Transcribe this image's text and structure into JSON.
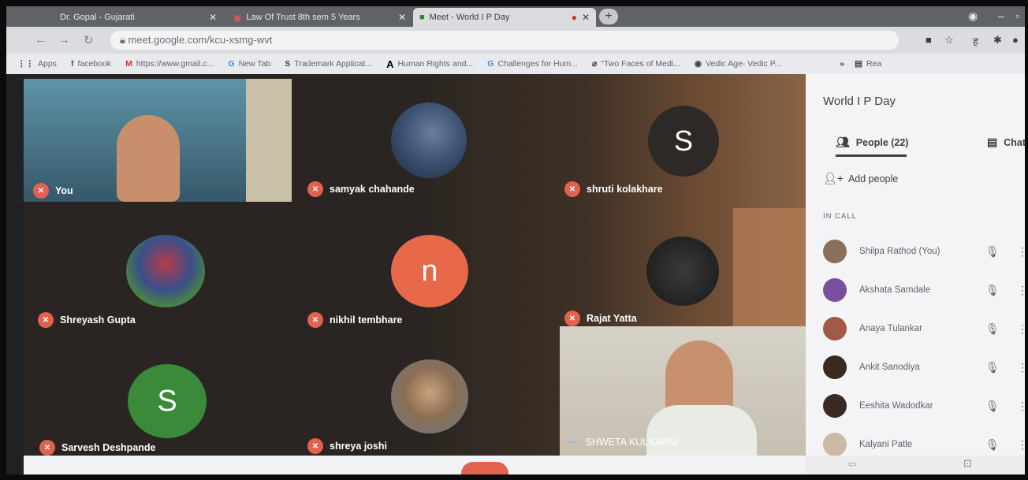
{
  "browser": {
    "tabs": [
      {
        "label": "Dr. Gopal - Gujarati"
      },
      {
        "label": "Law Of Trust 8th sem 5 Years"
      },
      {
        "label": "Meet - World I P Day"
      }
    ],
    "url": "meet.google.com/kcu-xsmg-wvt",
    "bookmarks": [
      {
        "icon": "⋮⋮",
        "label": "Apps"
      },
      {
        "icon": "f",
        "label": "facebook"
      },
      {
        "icon": "M",
        "label": "https://www.gmail.c..."
      },
      {
        "icon": "G",
        "label": "New Tab"
      },
      {
        "icon": "S",
        "label": "Trademark Applicat..."
      },
      {
        "icon": "A",
        "label": "Human Rights and..."
      },
      {
        "icon": "G",
        "label": "Challenges for Hum..."
      },
      {
        "icon": "⌀",
        "label": "\"Two Faces of Medi..."
      },
      {
        "icon": "◉",
        "label": "Vedic Age- Vedic P..."
      }
    ],
    "bookmarks_more": "»",
    "reading_list": "Rea"
  },
  "tiles": [
    {
      "name": "You",
      "type": "video"
    },
    {
      "name": "samyak chahande",
      "type": "photo"
    },
    {
      "name": "shruti kolakhare",
      "type": "letter",
      "letter": "S",
      "color": "#2d2926"
    },
    {
      "name": "Shreyash Gupta",
      "type": "photo"
    },
    {
      "name": "nikhil tembhare",
      "type": "letter",
      "letter": "n",
      "color": "#e8694a"
    },
    {
      "name": "Rajat Yatta",
      "type": "photo"
    },
    {
      "name": "Sarvesh Deshpande",
      "type": "letter",
      "letter": "S",
      "color": "#3a8a3a"
    },
    {
      "name": "shreya joshi",
      "type": "photo"
    },
    {
      "name": "SHWETA KULKARNI",
      "type": "video"
    }
  ],
  "panel": {
    "title": "World I P Day",
    "people_tab": "People (22)",
    "chat_tab": "Chat",
    "add_people": "Add people",
    "in_call_label": "IN CALL",
    "people": [
      {
        "name": "Shilpa Rathod (You)",
        "color": "#8a6f5a"
      },
      {
        "name": "Akshata Samdale",
        "color": "#7a4fa0"
      },
      {
        "name": "Anaya Tulankar",
        "color": "#a05a46"
      },
      {
        "name": "Ankit Sanodiya",
        "color": "#3b2a22"
      },
      {
        "name": "Eeshita Wadodkar",
        "color": "#3b2a22"
      },
      {
        "name": "Kalyani Patle",
        "color": "#c9b9a6"
      }
    ]
  }
}
